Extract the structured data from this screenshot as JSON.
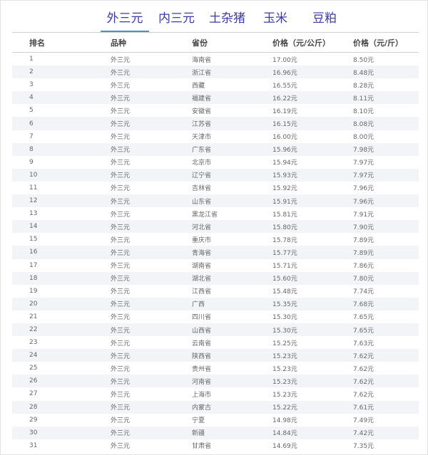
{
  "tabs": [
    {
      "label": "外三元",
      "active": true
    },
    {
      "label": "内三元",
      "active": false
    },
    {
      "label": "土杂猪",
      "active": false
    },
    {
      "label": "玉米",
      "active": false
    },
    {
      "label": "豆粕",
      "active": false
    }
  ],
  "table": {
    "headers": [
      "排名",
      "品种",
      "省份",
      "价格（元/公斤）",
      "价格（元/斤）"
    ],
    "rows": [
      [
        "1",
        "外三元",
        "海南省",
        "17.00元",
        "8.50元"
      ],
      [
        "2",
        "外三元",
        "浙江省",
        "16.96元",
        "8.48元"
      ],
      [
        "3",
        "外三元",
        "西藏",
        "16.55元",
        "8.28元"
      ],
      [
        "4",
        "外三元",
        "福建省",
        "16.22元",
        "8.11元"
      ],
      [
        "5",
        "外三元",
        "安徽省",
        "16.19元",
        "8.10元"
      ],
      [
        "6",
        "外三元",
        "江苏省",
        "16.15元",
        "8.08元"
      ],
      [
        "7",
        "外三元",
        "天津市",
        "16.00元",
        "8.00元"
      ],
      [
        "8",
        "外三元",
        "广东省",
        "15.96元",
        "7.98元"
      ],
      [
        "9",
        "外三元",
        "北京市",
        "15.94元",
        "7.97元"
      ],
      [
        "10",
        "外三元",
        "辽宁省",
        "15.93元",
        "7.97元"
      ],
      [
        "11",
        "外三元",
        "吉林省",
        "15.92元",
        "7.96元"
      ],
      [
        "12",
        "外三元",
        "山东省",
        "15.91元",
        "7.96元"
      ],
      [
        "13",
        "外三元",
        "黑龙江省",
        "15.81元",
        "7.91元"
      ],
      [
        "14",
        "外三元",
        "河北省",
        "15.80元",
        "7.90元"
      ],
      [
        "15",
        "外三元",
        "重庆市",
        "15.78元",
        "7.89元"
      ],
      [
        "16",
        "外三元",
        "青海省",
        "15.77元",
        "7.89元"
      ],
      [
        "17",
        "外三元",
        "湖南省",
        "15.71元",
        "7.86元"
      ],
      [
        "18",
        "外三元",
        "湖北省",
        "15.60元",
        "7.80元"
      ],
      [
        "19",
        "外三元",
        "江西省",
        "15.48元",
        "7.74元"
      ],
      [
        "20",
        "外三元",
        "广西",
        "15.35元",
        "7.68元"
      ],
      [
        "21",
        "外三元",
        "四川省",
        "15.30元",
        "7.65元"
      ],
      [
        "22",
        "外三元",
        "山西省",
        "15.30元",
        "7.65元"
      ],
      [
        "23",
        "外三元",
        "云南省",
        "15.25元",
        "7.63元"
      ],
      [
        "24",
        "外三元",
        "陕西省",
        "15.23元",
        "7.62元"
      ],
      [
        "25",
        "外三元",
        "贵州省",
        "15.23元",
        "7.62元"
      ],
      [
        "26",
        "外三元",
        "河南省",
        "15.23元",
        "7.62元"
      ],
      [
        "27",
        "外三元",
        "上海市",
        "15.23元",
        "7.62元"
      ],
      [
        "28",
        "外三元",
        "内蒙古",
        "15.22元",
        "7.61元"
      ],
      [
        "29",
        "外三元",
        "宁夏",
        "14.98元",
        "7.49元"
      ],
      [
        "30",
        "外三元",
        "新疆",
        "14.84元",
        "7.42元"
      ],
      [
        "31",
        "外三元",
        "甘肃省",
        "14.69元",
        "7.35元"
      ]
    ]
  }
}
